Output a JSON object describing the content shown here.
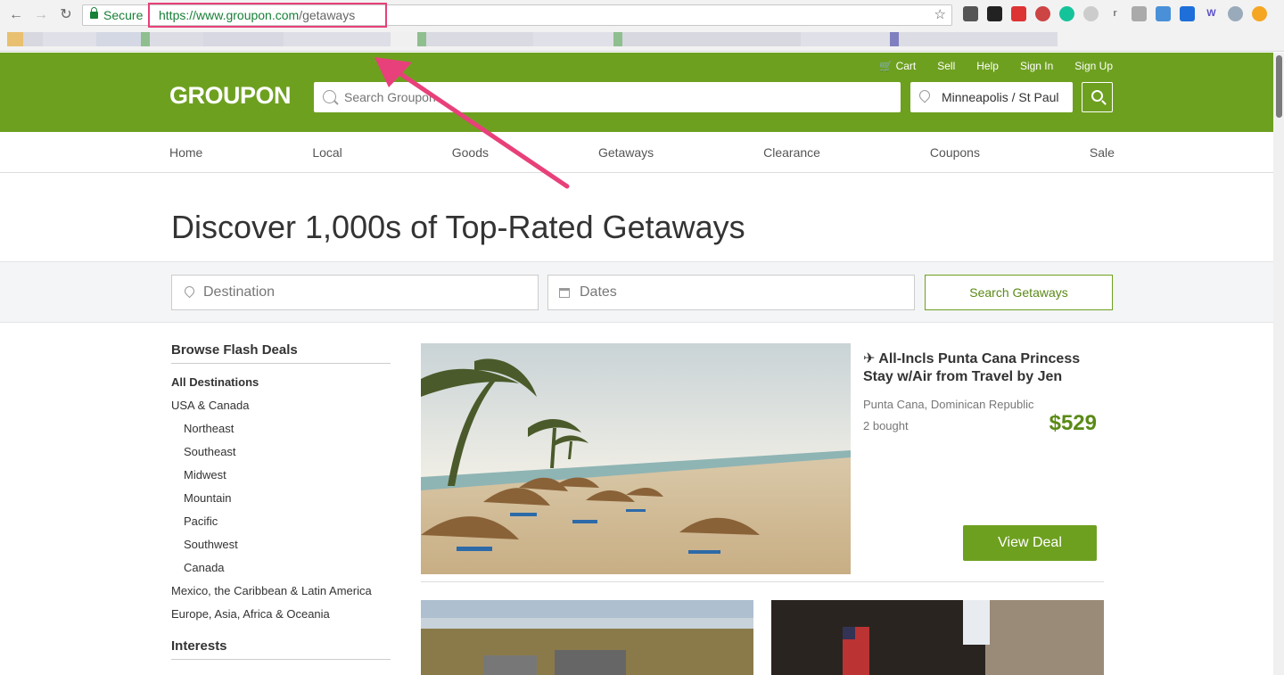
{
  "browser": {
    "secure_label": "Secure",
    "url_scheme_host": "https://www.groupon.com",
    "url_path": "/getaways"
  },
  "header": {
    "logo": "GROUPON",
    "links": [
      "Cart",
      "Sell",
      "Help",
      "Sign In",
      "Sign Up"
    ],
    "search_placeholder": "Search Groupon",
    "location": "Minneapolis / St Paul"
  },
  "nav": {
    "items": [
      "Home",
      "Local",
      "Goods",
      "Getaways",
      "Clearance",
      "Coupons",
      "Sale"
    ]
  },
  "page": {
    "title": "Discover 1,000s of Top-Rated Getaways",
    "destination_placeholder": "Destination",
    "dates_placeholder": "Dates",
    "search_button": "Search Getaways"
  },
  "sidebar": {
    "heading": "Browse Flash Deals",
    "items": [
      {
        "label": "All Destinations",
        "style": "bold"
      },
      {
        "label": "USA & Canada",
        "style": "top"
      },
      {
        "label": "Northeast",
        "style": "sub"
      },
      {
        "label": "Southeast",
        "style": "sub"
      },
      {
        "label": "Midwest",
        "style": "sub"
      },
      {
        "label": "Mountain",
        "style": "sub"
      },
      {
        "label": "Pacific",
        "style": "sub"
      },
      {
        "label": "Southwest",
        "style": "sub"
      },
      {
        "label": "Canada",
        "style": "sub"
      },
      {
        "label": "Mexico, the Caribbean & Latin America",
        "style": "top"
      },
      {
        "label": "Europe, Asia, Africa & Oceania",
        "style": "top"
      }
    ],
    "heading2": "Interests"
  },
  "deal": {
    "title": "✈ All-Incls Punta Cana Princess Stay w/Air from Travel by Jen",
    "location": "Punta Cana, Dominican Republic",
    "bought": "2 bought",
    "price": "$529",
    "button": "View Deal"
  },
  "colors": {
    "brand_green": "#6ea020",
    "annotation_pink": "#e8407a"
  }
}
